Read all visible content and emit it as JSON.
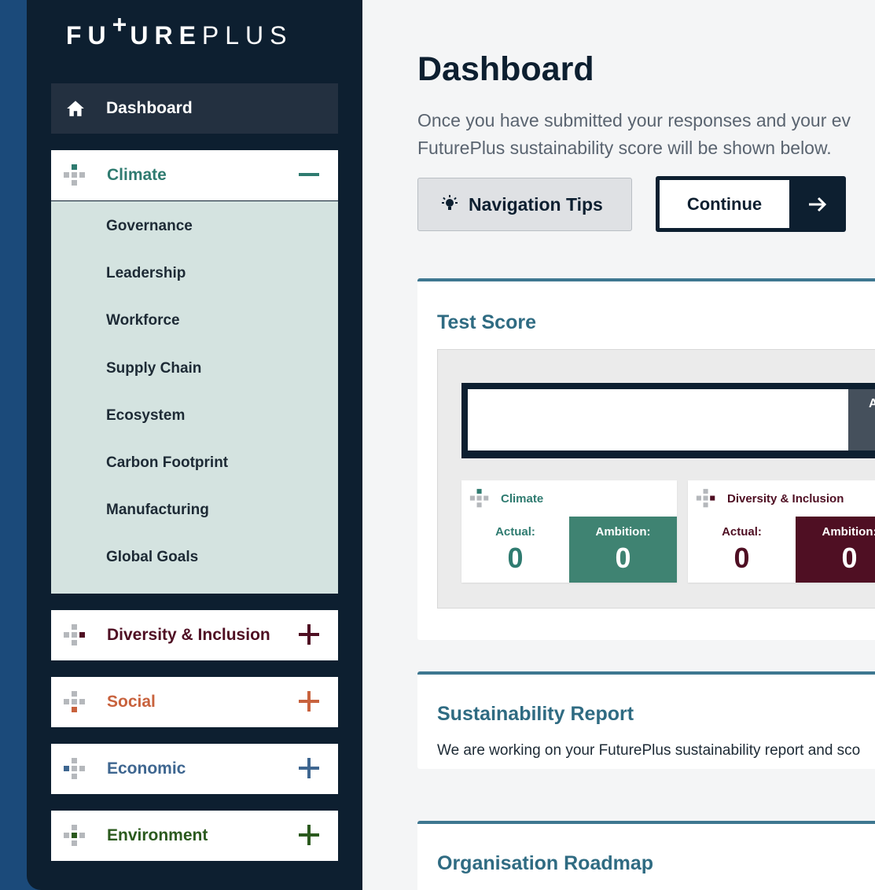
{
  "logo": {
    "bold_a": "FU",
    "plus": "+",
    "bold_b": "URE",
    "light": "PLUS"
  },
  "sidebar": {
    "dashboard_label": "Dashboard",
    "categories": [
      {
        "label": "Climate",
        "color": "#2f7b70",
        "toggle": "minus",
        "expanded": true
      },
      {
        "label": "Diversity & Inclusion",
        "color": "#4f0f23",
        "toggle": "plus"
      },
      {
        "label": "Social",
        "color": "#c8623d",
        "toggle": "plus"
      },
      {
        "label": "Economic",
        "color": "#3e6690",
        "toggle": "plus"
      },
      {
        "label": "Environment",
        "color": "#2b5a1e",
        "toggle": "plus"
      }
    ],
    "climate_items": [
      "Governance",
      "Leadership",
      "Workforce",
      "Supply Chain",
      "Ecosystem",
      "Carbon Footprint",
      "Manufacturing",
      "Global Goals"
    ]
  },
  "main": {
    "title": "Dashboard",
    "intro_line1": "Once you have submitted your responses and your ev",
    "intro_line2": "FuturePlus sustainability score will be shown below.",
    "tips_label": "Navigation Tips",
    "continue_label": "Continue",
    "test_score": {
      "title": "Test Score",
      "bar_label": "A",
      "cards": [
        {
          "name": "Climate",
          "color": "#2f7b70",
          "actual_label": "Actual:",
          "actual": "0",
          "ambition_label": "Ambition:",
          "ambition": "0",
          "ambition_bg": "#3f8372"
        },
        {
          "name": "Diversity & Inclusion",
          "color": "#4f0f23",
          "actual_label": "Actual:",
          "actual": "0",
          "ambition_label": "Ambition:",
          "ambition": "0",
          "ambition_bg": "#4f0f23"
        }
      ]
    },
    "report": {
      "title": "Sustainability Report",
      "text": "We are working on your FuturePlus sustainability report and sco"
    },
    "roadmap": {
      "title": "Organisation Roadmap"
    }
  },
  "colors": {
    "sidebar_bg": "#0d1f30",
    "page_bg": "#1b4a7a",
    "accent": "#2f6b82"
  }
}
